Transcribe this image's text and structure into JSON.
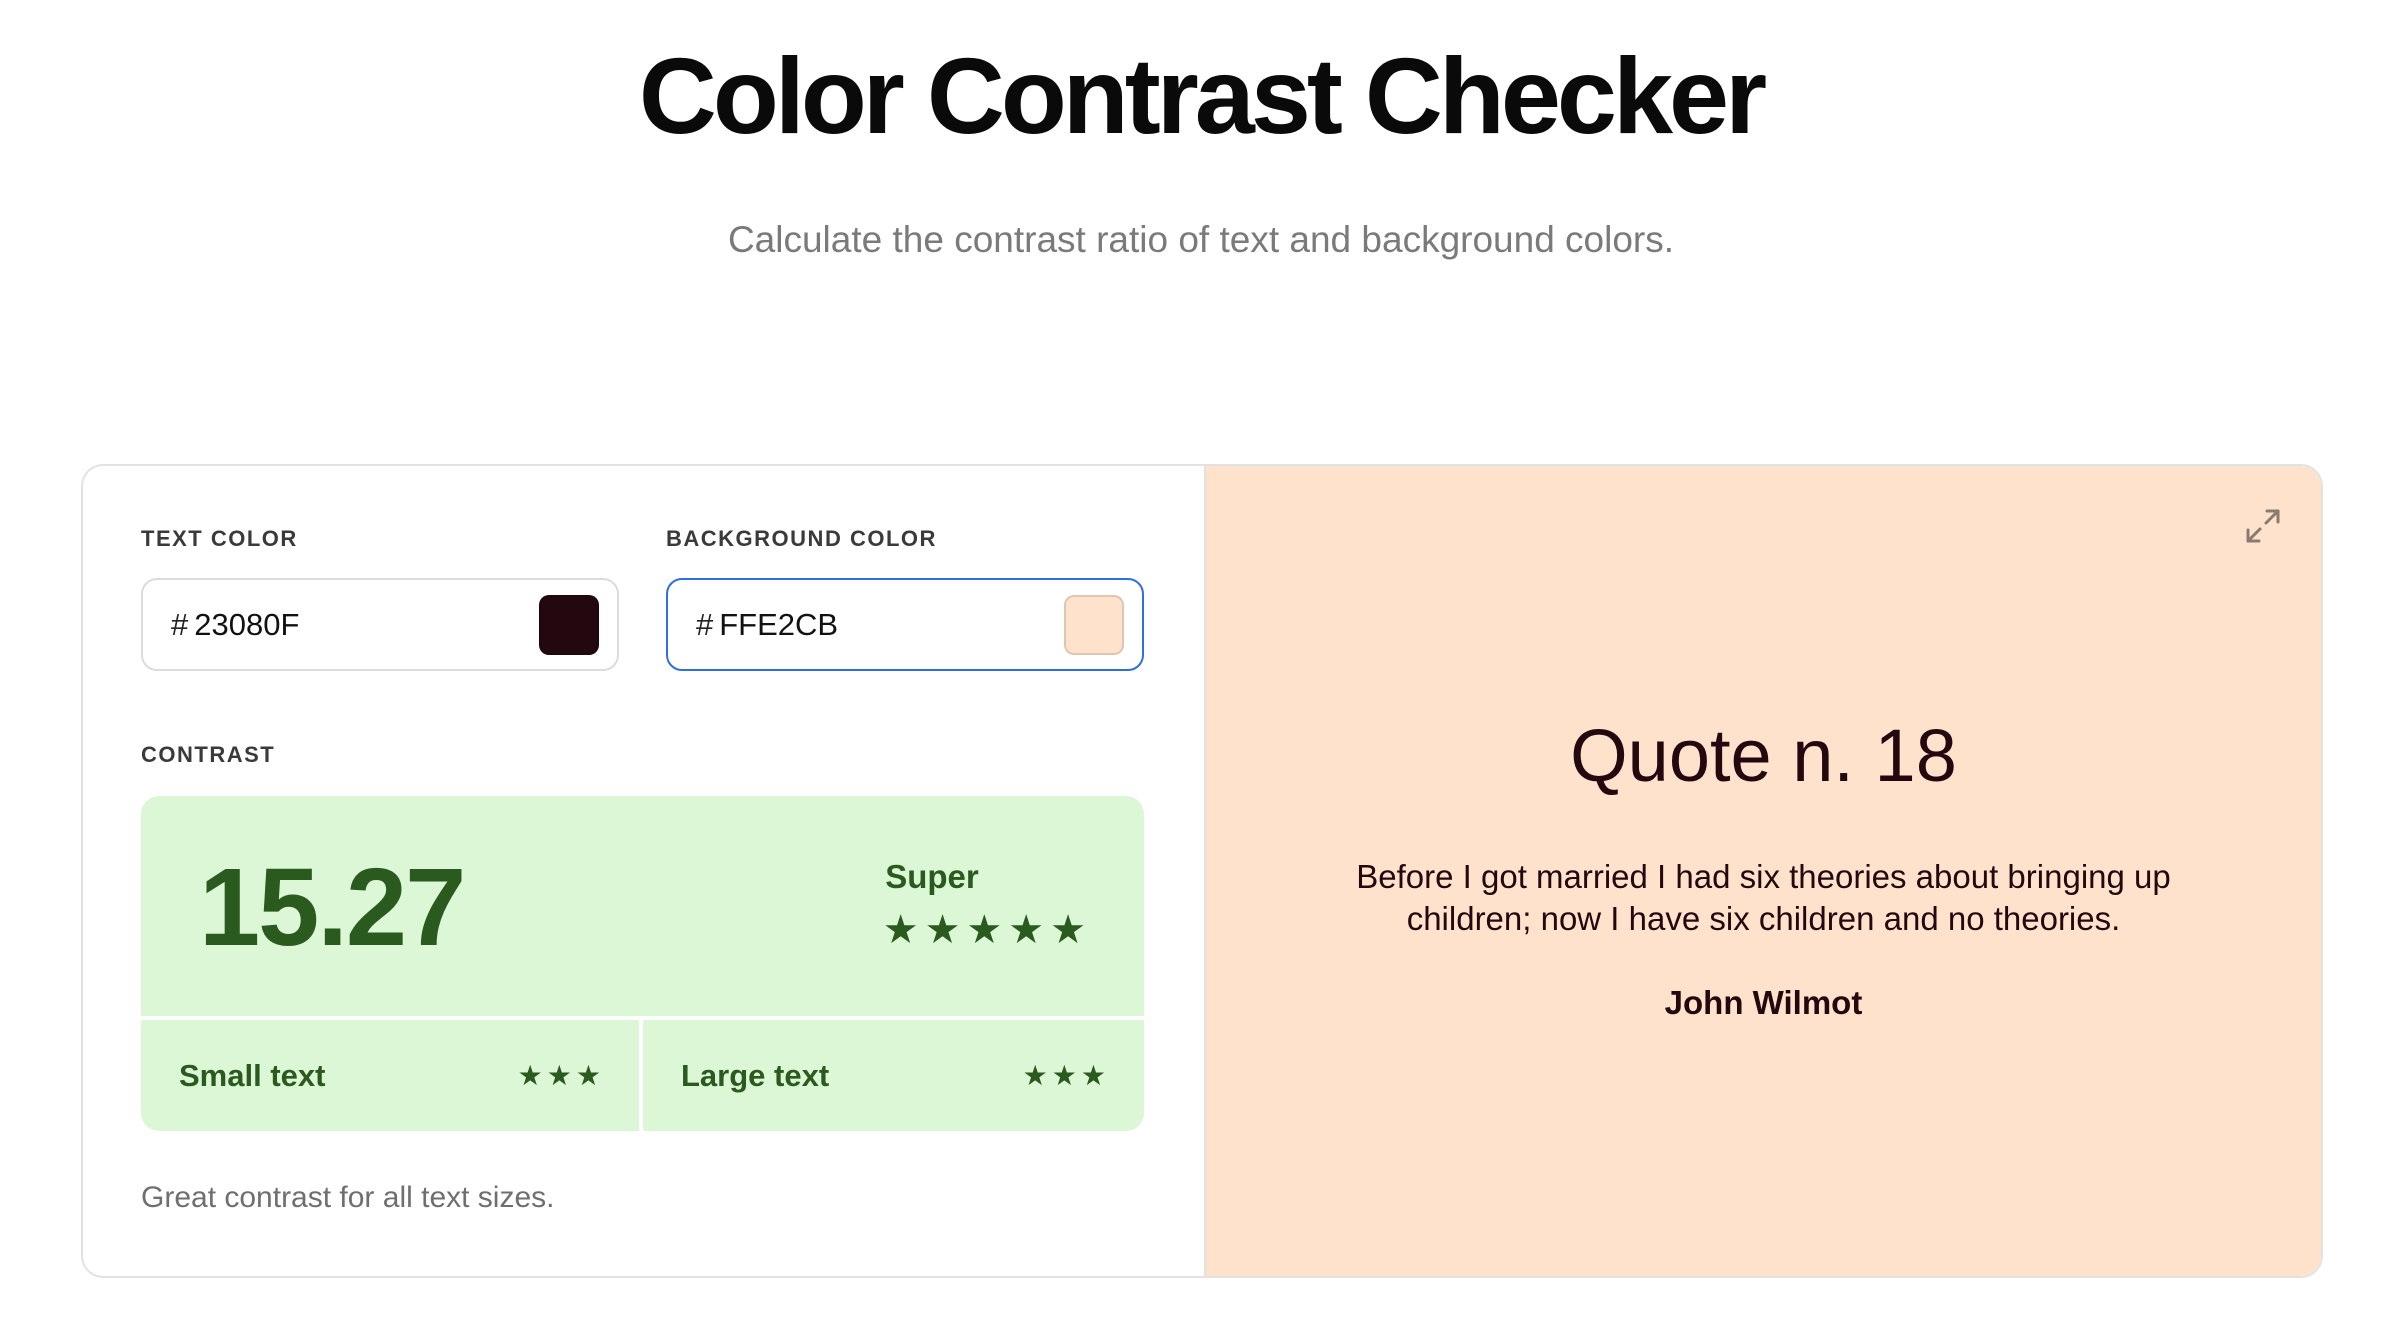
{
  "header": {
    "title": "Color Contrast Checker",
    "subtitle": "Calculate the contrast ratio of text and background colors."
  },
  "text_color": {
    "label": "TEXT COLOR",
    "hash": "#",
    "value": "23080F",
    "swatch": "#23080F"
  },
  "background_color": {
    "label": "BACKGROUND COLOR",
    "hash": "#",
    "value": "FFE2CB",
    "swatch": "#FFE2CB"
  },
  "contrast": {
    "label": "CONTRAST",
    "ratio": "15.27",
    "rating": "Super",
    "rating_stars": 5,
    "small_text_label": "Small text",
    "small_text_stars": 3,
    "large_text_label": "Large text",
    "large_text_stars": 3,
    "message": "Great contrast for all text sizes.",
    "pass_color": "#2A5A1E",
    "pass_bg": "#DBF7D6"
  },
  "preview": {
    "icon": "expand-icon",
    "title": "Quote n. 18",
    "quote": "Before I got married I had six theories about bringing up children; now I have six children and no theories.",
    "author": "John Wilmot"
  }
}
